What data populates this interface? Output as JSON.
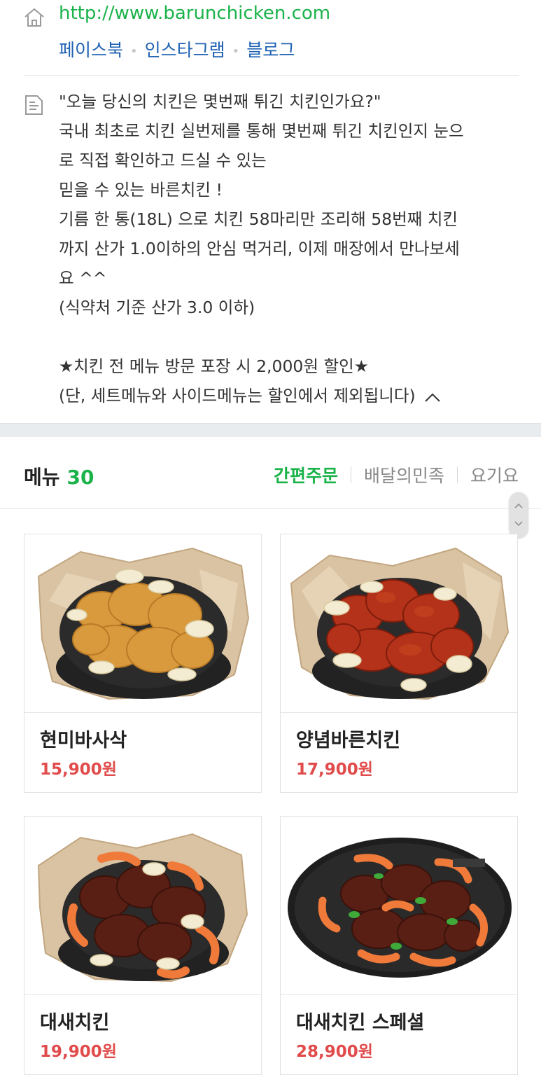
{
  "header": {
    "url": "http://www.barunchicken.com",
    "sns": [
      "페이스북",
      "인스타그램",
      "블로그"
    ]
  },
  "description": {
    "lines": [
      "\"오늘 당신의 치킨은 몇번째 튀긴 치킨인가요?\"",
      "국내 최초로 치킨 실번제를 통해 몇번째 튀긴 치킨인지 눈으",
      "로 직접 확인하고 드실 수 있는",
      "믿을 수 있는 바른치킨 !",
      "기름 한 통(18L) 으로 치킨 58마리만 조리해 58번째 치킨",
      "까지 산가 1.0이하의 안심 먹거리, 이제 매장에서 만나보세",
      "요 ^^",
      "(식약처 기준 산가 3.0 이하)",
      "",
      "★치킨 전 메뉴 방문 포장 시 2,000원 할인★",
      "(단, 세트메뉴와 사이드메뉴는 할인에서 제외됩니다)"
    ]
  },
  "menu": {
    "title": "메뉴",
    "count": "30",
    "tabs": [
      "간편주문",
      "배달의민족",
      "요기요"
    ],
    "items": [
      {
        "name": "현미바사삭",
        "price": "15,900원",
        "icon": "fried-chicken-plain-image"
      },
      {
        "name": "양념바른치킨",
        "price": "17,900원",
        "icon": "fried-chicken-sauced-image"
      },
      {
        "name": "대새치킨",
        "price": "19,900원",
        "icon": "chicken-shrimp-image"
      },
      {
        "name": "대새치킨 스페셜",
        "price": "28,900원",
        "icon": "chicken-shrimp-special-image"
      }
    ]
  },
  "colors": {
    "accent_green": "#1ab34a",
    "link_blue": "#1f62b3",
    "price_red": "#e14b4b"
  }
}
